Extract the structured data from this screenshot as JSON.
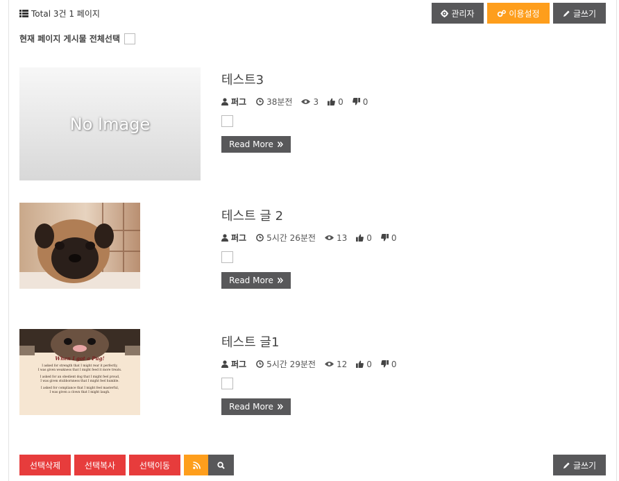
{
  "header": {
    "total_label": "Total 3건 1 페이지",
    "admin_label": "관리자",
    "settings_label": "이용설정",
    "write_label": "글쓰기"
  },
  "select_all_label": "현재 페이지 게시물 전체선택",
  "posts": [
    {
      "title": "테스트3",
      "author": "퍼그",
      "time": "38분전",
      "views": "3",
      "likes": "0",
      "dislikes": "0",
      "thumbnail": "No Image",
      "read_more": "Read More"
    },
    {
      "title": "테스트 글 2",
      "author": "퍼그",
      "time": "5시간 26분전",
      "views": "13",
      "likes": "0",
      "dislikes": "0",
      "thumbnail": "pug-photo",
      "read_more": "Read More"
    },
    {
      "title": "테스트 글1",
      "author": "퍼그",
      "time": "5시간 29분전",
      "views": "12",
      "likes": "0",
      "dislikes": "0",
      "thumbnail": "pug-poem-card",
      "read_more": "Read More"
    }
  ],
  "poem": {
    "title": "When I got a Pug!",
    "lines": [
      "I asked for strength that I might rear it perfectly,",
      "I was given weakness that I might feed it more treats.",
      "I asked for an obedient dog that I might feel proud,",
      "I was given stubbornness that I might feel humble.",
      "I asked for compliance that I might feel masterful,",
      "I was given a clown that I might laugh."
    ]
  },
  "footer": {
    "delete_label": "선택삭제",
    "copy_label": "선택복사",
    "move_label": "선택이동",
    "write_label": "글쓰기"
  },
  "colors": {
    "dark_button": "#58585a",
    "orange_button": "#fe9e1c",
    "red_button": "#e73c3c"
  }
}
